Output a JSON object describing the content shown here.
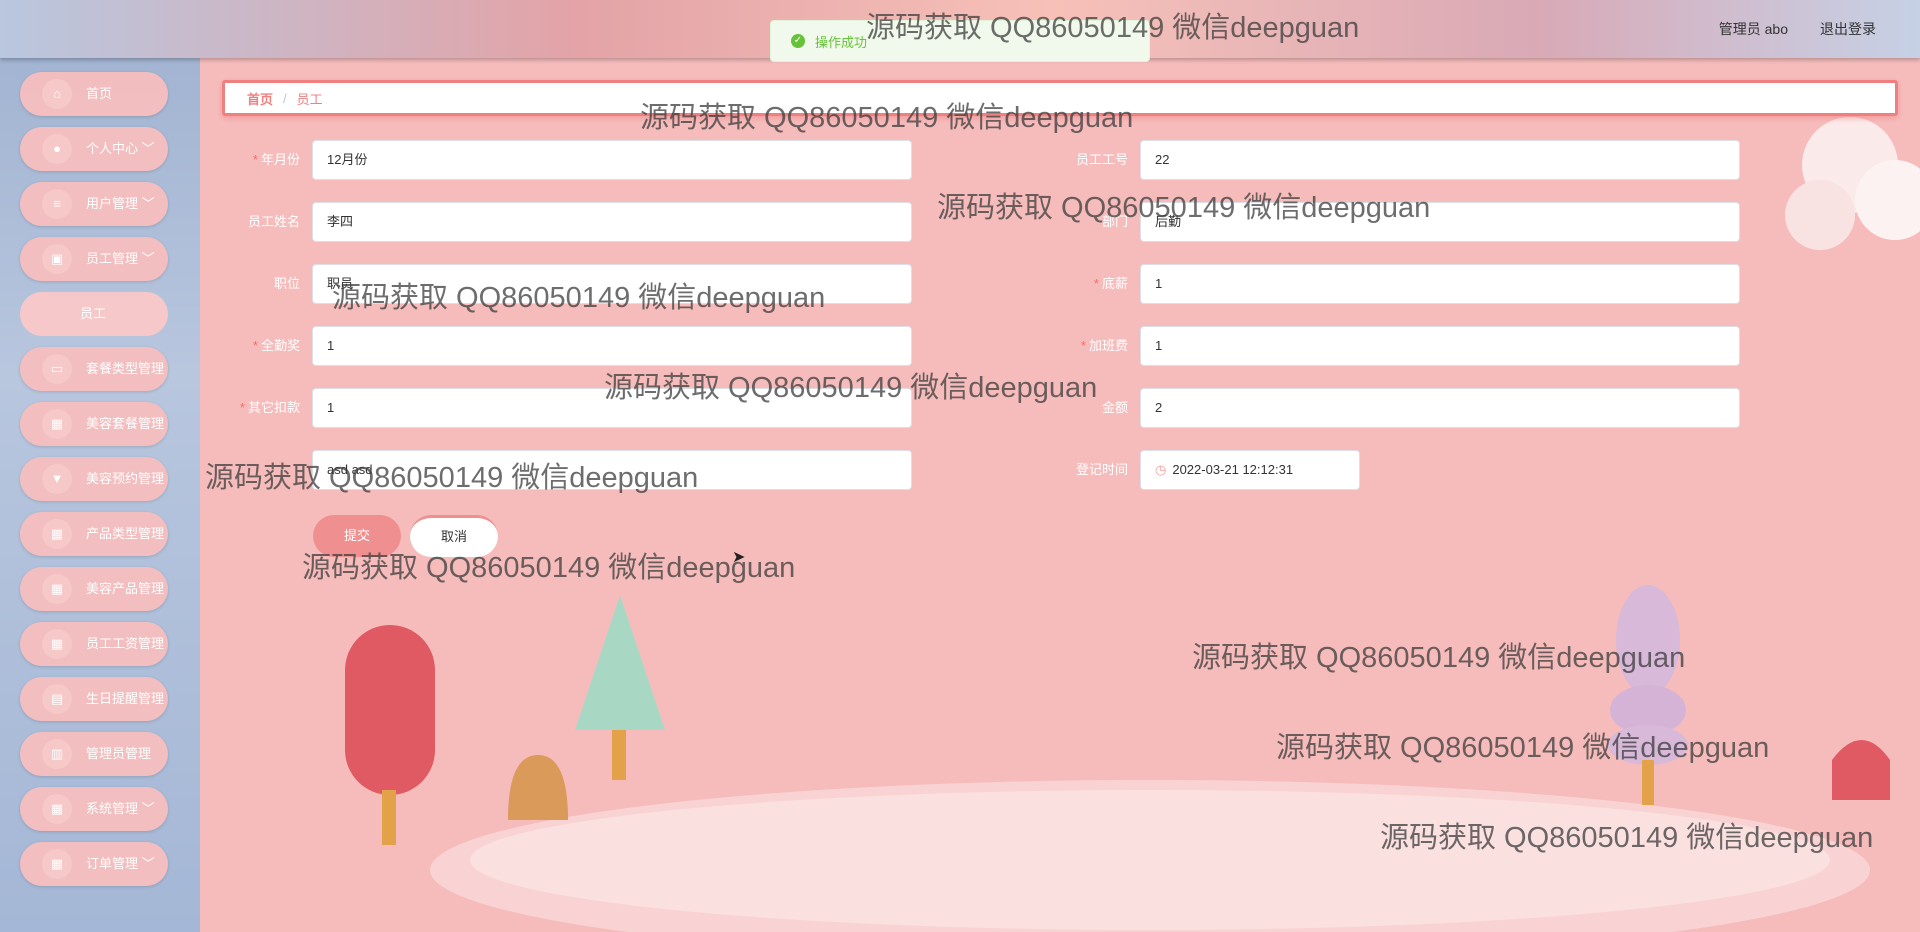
{
  "header": {
    "user_label": "管理员 abo",
    "logout_label": "退出登录"
  },
  "toast": {
    "message": "操作成功"
  },
  "sidebar": {
    "items": [
      {
        "label": "首页",
        "icon": "home-icon"
      },
      {
        "label": "个人中心",
        "icon": "user-icon",
        "expandable": true
      },
      {
        "label": "用户管理",
        "icon": "menu-icon",
        "expandable": true
      },
      {
        "label": "员工管理",
        "icon": "staff-icon",
        "expandable": true
      },
      {
        "label": "员工",
        "sub": true
      },
      {
        "label": "套餐类型管理",
        "icon": "monitor-icon"
      },
      {
        "label": "美容套餐管理",
        "icon": "grid-icon"
      },
      {
        "label": "美容预约管理",
        "icon": "pin-icon"
      },
      {
        "label": "产品类型管理",
        "icon": "grid-icon"
      },
      {
        "label": "美容产品管理",
        "icon": "grid-icon"
      },
      {
        "label": "员工工资管理",
        "icon": "grid-icon"
      },
      {
        "label": "生日提醒管理",
        "icon": "calendar-icon"
      },
      {
        "label": "管理员管理",
        "icon": "doc-icon"
      },
      {
        "label": "系统管理",
        "icon": "grid-icon",
        "expandable": true
      },
      {
        "label": "订单管理",
        "icon": "grid-icon",
        "expandable": true
      }
    ]
  },
  "breadcrumb": {
    "home": "首页",
    "separator": "/",
    "current": "员工"
  },
  "form": {
    "month": {
      "label": "年月份",
      "value": "12月份",
      "required": true
    },
    "emp_no": {
      "label": "员工工号",
      "value": "22"
    },
    "emp_name": {
      "label": "员工姓名",
      "value": "李四"
    },
    "dept": {
      "label": "部门",
      "value": "后勤"
    },
    "position": {
      "label": "职位",
      "value": "职员"
    },
    "base_salary": {
      "label": "底薪",
      "value": "1",
      "required": true
    },
    "attendance_bonus": {
      "label": "全勤奖",
      "value": "1",
      "required": true
    },
    "overtime": {
      "label": "加班费",
      "value": "1",
      "required": true
    },
    "deduction": {
      "label": "其它扣款",
      "value": "1",
      "required": true
    },
    "amount": {
      "label": "金额",
      "value": "2"
    },
    "remark": {
      "value": "asd asd"
    },
    "reg_time": {
      "label": "登记时间",
      "value": "2022-03-21 12:12:31"
    },
    "submit_label": "提交",
    "cancel_label": "取消"
  },
  "watermark": "源码获取 QQ86050149 微信deepguan",
  "colors": {
    "accent": "#f08080",
    "success": "#67c23a",
    "required": "#f56c6c"
  }
}
